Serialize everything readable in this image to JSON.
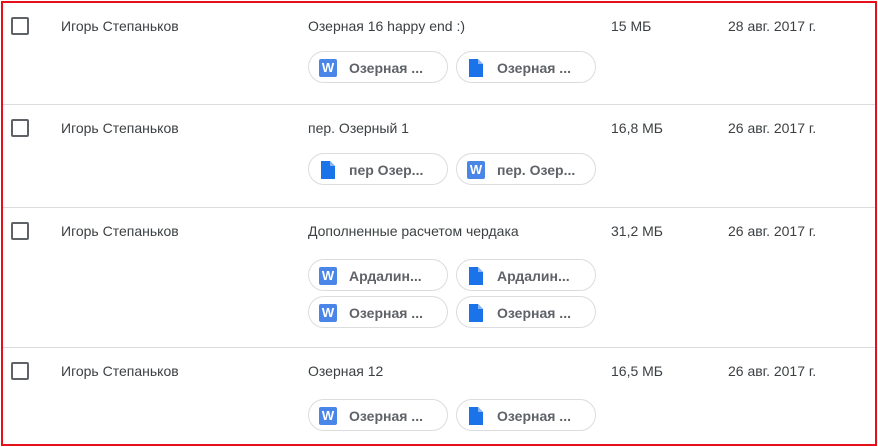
{
  "rows": [
    {
      "sender": "Игорь Степаньков",
      "subject": "Озерная 16 happy end :)",
      "size": "15 МБ",
      "date": "28 авг. 2017 г.",
      "attachments": [
        {
          "type": "word",
          "icon": "word-doc-icon",
          "label": "Озерная ..."
        },
        {
          "type": "doc",
          "icon": "blue-file-icon",
          "label": "Озерная ..."
        }
      ]
    },
    {
      "sender": "Игорь Степаньков",
      "subject": "пер. Озерный 1",
      "size": "16,8 МБ",
      "date": "26 авг. 2017 г.",
      "attachments": [
        {
          "type": "doc",
          "icon": "blue-file-icon",
          "label": "пер Озер..."
        },
        {
          "type": "word",
          "icon": "word-doc-icon",
          "label": "пер. Озер..."
        }
      ]
    },
    {
      "sender": "Игорь Степаньков",
      "subject": "Дополненные расчетом чердака",
      "size": "31,2 МБ",
      "date": "26 авг. 2017 г.",
      "attachments": [
        {
          "type": "word",
          "icon": "word-doc-icon",
          "label": "Ардалин..."
        },
        {
          "type": "doc",
          "icon": "blue-file-icon",
          "label": "Ардалин..."
        },
        {
          "type": "word",
          "icon": "word-doc-icon",
          "label": "Озерная ..."
        },
        {
          "type": "doc",
          "icon": "blue-file-icon",
          "label": "Озерная ..."
        }
      ]
    },
    {
      "sender": "Игорь Степаньков",
      "subject": "Озерная 12",
      "size": "16,5 МБ",
      "date": "26 авг. 2017 г.",
      "attachments": [
        {
          "type": "word",
          "icon": "word-doc-icon",
          "label": "Озерная ..."
        },
        {
          "type": "doc",
          "icon": "blue-file-icon",
          "label": "Озерная ..."
        }
      ]
    }
  ],
  "colors": {
    "frame_border": "#e5101a",
    "word_icon": "#4a86e8",
    "file_icon": "#1a73e8",
    "divider": "#dadce0"
  }
}
